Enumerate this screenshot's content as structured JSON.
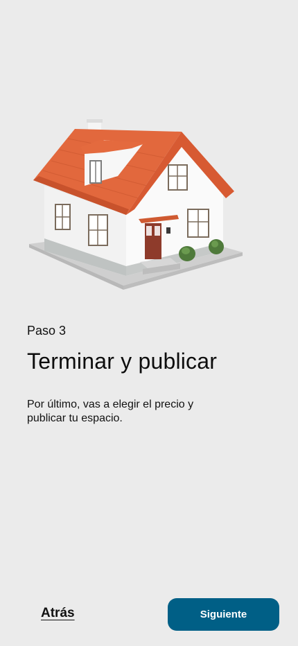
{
  "hero": {
    "image_name": "house-illustration",
    "colors": {
      "roof": "#e0653b",
      "roof_dark": "#c44f2b",
      "wall": "#f4f4f4",
      "wall_shadow": "#d9d9d9",
      "door": "#8e3b2b",
      "shrub": "#4f7a3b",
      "ground": "#c9c9c9"
    }
  },
  "content": {
    "step_label": "Paso 3",
    "title": "Terminar y publicar",
    "description": "Por último, vas a elegir el precio y publicar tu espacio."
  },
  "footer": {
    "back_label": "Atrás",
    "next_label": "Siguiente",
    "next_color": "#005f86"
  }
}
